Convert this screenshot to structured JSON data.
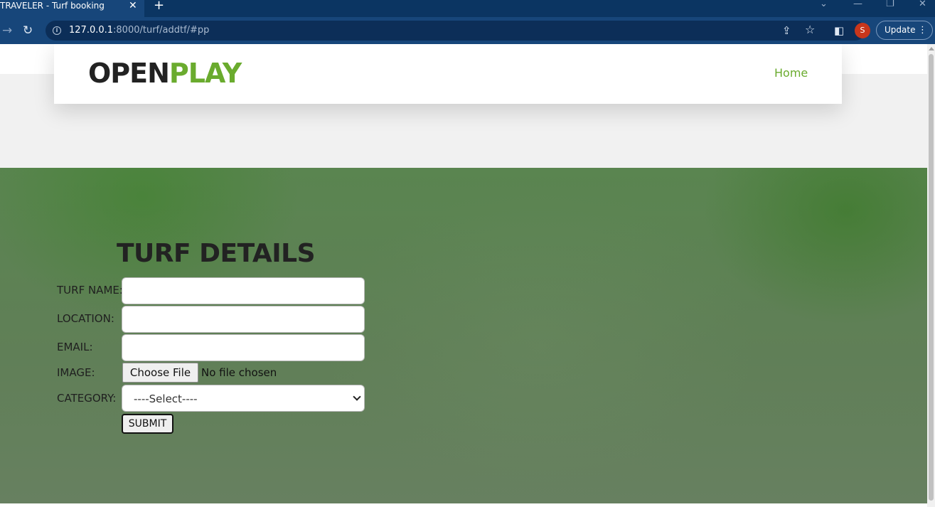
{
  "browser": {
    "tab_title": "TRAVELER - Turf booking",
    "tab_close": "✕",
    "new_tab": "+",
    "url_host": "127.0.0.1",
    "url_rest": ":8000/turf/addtf/#pp",
    "profile_initial": "S",
    "update_label": "Update"
  },
  "nav": {
    "logo_open": "OPEN",
    "logo_play": "PLAY",
    "home_link": "Home"
  },
  "form": {
    "title": "TURF DETAILS",
    "turf_name_label": "TURF NAME:",
    "location_label": "LOCATION:",
    "email_label": "EMAIL:",
    "image_label": "IMAGE:",
    "choose_file_label": "Choose File",
    "file_status": "No file chosen",
    "category_label": "CATEGORY:",
    "category_selected": "----Select----",
    "submit_label": "SUBMIT"
  },
  "colors": {
    "brand_green": "#6aab2e",
    "chrome_blue": "#17467a"
  }
}
